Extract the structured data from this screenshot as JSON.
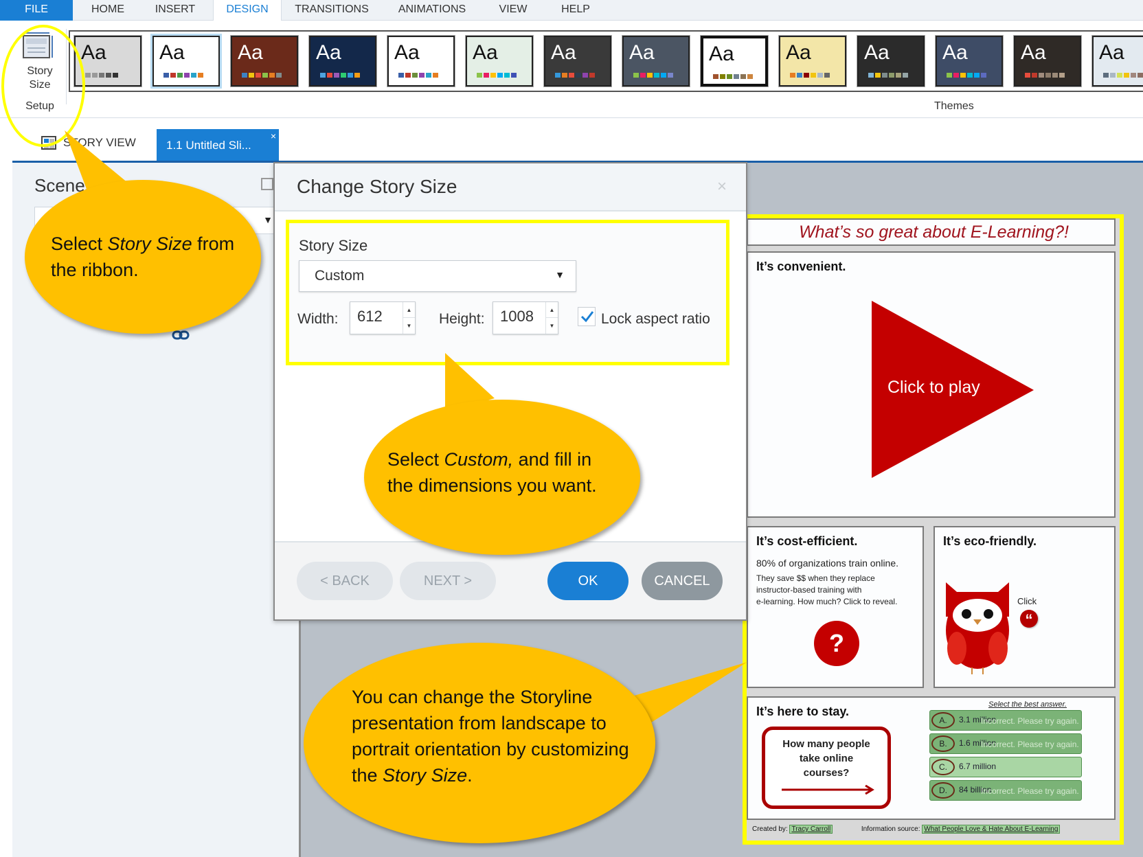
{
  "menu": {
    "tabs": [
      {
        "label": "FILE"
      },
      {
        "label": "HOME"
      },
      {
        "label": "INSERT"
      },
      {
        "label": "DESIGN"
      },
      {
        "label": "TRANSITIONS"
      },
      {
        "label": "ANIMATIONS"
      },
      {
        "label": "VIEW"
      },
      {
        "label": "HELP"
      }
    ],
    "active_tab": "DESIGN"
  },
  "ribbon": {
    "story_size_line1": "Story",
    "story_size_line2": "Size",
    "setup_group_label": "Setup",
    "themes_group_label": "Themes",
    "theme_preview_text": "Aa",
    "themes": [
      {
        "bg": "#d9d9d9",
        "fg": "#111111",
        "swatches": [
          "#999999",
          "#999999",
          "#777777",
          "#555555",
          "#333333"
        ]
      },
      {
        "bg": "#ffffff",
        "fg": "#111111",
        "swatches": [
          "#3a5fa8",
          "#c0392b",
          "#4a9b48",
          "#8e44ad",
          "#2aa3c9",
          "#e67e22"
        ],
        "selected": true
      },
      {
        "bg": "#6b2a1a",
        "fg": "#ffffff",
        "swatches": [
          "#3c82c4",
          "#f1c40f",
          "#e74c3c",
          "#8bc34a",
          "#e67e22",
          "#7f8c8d"
        ]
      },
      {
        "bg": "#13284a",
        "fg": "#ffffff",
        "swatches": [
          "#4fa3e0",
          "#e74c3c",
          "#9b59b6",
          "#2ecc71",
          "#3498db",
          "#f39c12"
        ]
      },
      {
        "bg": "#ffffff",
        "fg": "#111111",
        "swatches": [
          "#3a5fa8",
          "#c0392b",
          "#6c8e3b",
          "#8e44ad",
          "#2aa3c9",
          "#e67e22"
        ]
      },
      {
        "bg": "#e4efe6",
        "fg": "#111111",
        "swatches": [
          "#8bc34a",
          "#e91e63",
          "#ffc107",
          "#03a9f4",
          "#00bcd4",
          "#3f51b5"
        ]
      },
      {
        "bg": "#3a3a3a",
        "fg": "#ffffff",
        "swatches": [
          "#3498db",
          "#e67e22",
          "#e74c3c",
          "#2c3e50",
          "#8e44ad",
          "#c0392b"
        ]
      },
      {
        "bg": "#4b5563",
        "fg": "#ffffff",
        "swatches": [
          "#8bc34a",
          "#e91e63",
          "#ffc107",
          "#00bcd4",
          "#03a9f4",
          "#7986cb"
        ]
      },
      {
        "bg": "#ffffff",
        "fg": "#111111",
        "swatches": [
          "#a0522d",
          "#808000",
          "#6b8e23",
          "#708090",
          "#8b7355",
          "#cd853f"
        ],
        "thick": true
      },
      {
        "bg": "#f3e6a8",
        "fg": "#111111",
        "swatches": [
          "#e67e22",
          "#3c82c4",
          "#8b0000",
          "#f1c40f",
          "#a9b8c9",
          "#666666"
        ]
      },
      {
        "bg": "#2b2b2b",
        "fg": "#ffffff",
        "swatches": [
          "#7fb3d5",
          "#f1c40f",
          "#7f8c8d",
          "#8d9b6a",
          "#a6a17a",
          "#95a5a6"
        ]
      },
      {
        "bg": "#3e4c66",
        "fg": "#ffffff",
        "swatches": [
          "#8bc34a",
          "#e91e63",
          "#ffc107",
          "#00bcd4",
          "#03a9f4",
          "#5c6bc0"
        ]
      },
      {
        "bg": "#2f2a26",
        "fg": "#ffffff",
        "swatches": [
          "#e74c3c",
          "#c0392b",
          "#a08c7d",
          "#8d7b6a",
          "#9b8a78",
          "#b39f89"
        ]
      },
      {
        "bg": "#e3eaf0",
        "fg": "#111111",
        "swatches": [
          "#5d6d7e",
          "#aab7c4",
          "#d4e157",
          "#f1c40f",
          "#a1887f",
          "#8d6e63"
        ]
      }
    ]
  },
  "tabstrip": {
    "story_view_label": "STORY VIEW",
    "slide_tab_label": "1.1 Untitled Sli...",
    "slide_tab_close": "×"
  },
  "scene_panel": {
    "title": "Scenes",
    "dropdown_arrow": "▼"
  },
  "dialog": {
    "title": "Change Story Size",
    "close_glyph": "×",
    "story_size_heading": "Story Size",
    "size_select_value": "Custom",
    "select_arrow": "▼",
    "width_label": "Width:",
    "width_value": "612",
    "height_label": "Height:",
    "height_value": "1008",
    "spin_up": "▲",
    "spin_down": "▼",
    "lock_aspect_ratio_label": "Lock aspect ratio",
    "lock_aspect_ratio_checked": true,
    "back_label": "< BACK",
    "next_label": "NEXT >",
    "ok_label": "OK",
    "cancel_label": "CANCEL"
  },
  "slide": {
    "title": "What’s so great about E-Learning?!",
    "card1_heading": "It’s convenient.",
    "play_label": "Click to play",
    "card2_heading": "It’s cost-efficient.",
    "card2_stat": "80% of organizations train online.",
    "card2_body_lines": [
      "They save $$ when they replace",
      "instructor-based training with",
      "e-learning. How much? Click to reveal."
    ],
    "card2_qmark": "?",
    "card3_heading": "It’s eco-friendly.",
    "card3_click": "Click",
    "card3_quote": "“",
    "card4_heading": "It’s here to stay.",
    "question_lines": [
      "How many people",
      "take online",
      "courses?"
    ],
    "select_best": "Select the best answer.",
    "answers": [
      {
        "letter": "A.",
        "text": "3.1 million",
        "feedback": "Incorrect. Please try again."
      },
      {
        "letter": "B.",
        "text": "1.6 million",
        "feedback": "Incorrect. Please try again."
      },
      {
        "letter": "C.",
        "text": "6.7 million",
        "feedback": ""
      },
      {
        "letter": "D.",
        "text": "84 billion",
        "feedback": "Incorrect. Please try again."
      }
    ],
    "footer_created_by_label": "Created by:",
    "footer_created_by_name": "Tracy Carroll",
    "footer_source_label": "Information source:",
    "footer_source_link": "What People Love & Hate About E-Learning"
  },
  "callouts": {
    "ribbon_callout": {
      "pre": "Select ",
      "em": "Story Size",
      "post": " from the ribbon."
    },
    "custom_callout": {
      "pre": "Select ",
      "em": "Custom,",
      "post": " and fill in the dimensions you want."
    },
    "orientation_callout": {
      "pre": "You can change the Storyline presentation from landscape to portrait orientation by customizing the ",
      "em": "Story Size",
      "post": "."
    }
  },
  "colors": {
    "accent_blue": "#1a7fd4",
    "callout_yellow": "#ffc000",
    "highlight_yellow": "#ffff00",
    "slide_red": "#c40000"
  }
}
